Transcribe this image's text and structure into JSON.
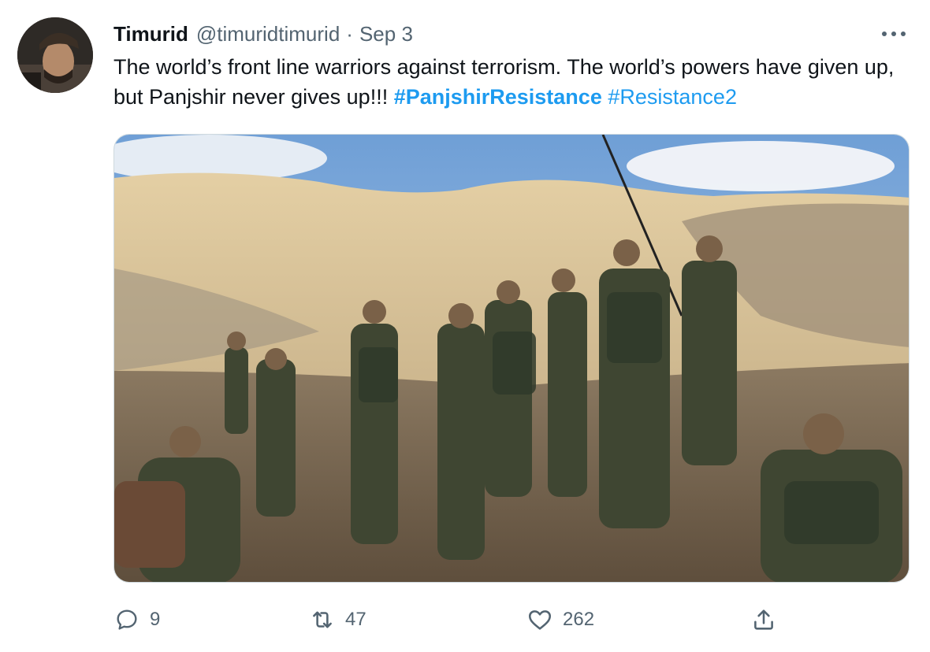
{
  "author": {
    "name": "Timurid",
    "handle": "@timuridtimurid",
    "separator": "·",
    "date": "Sep 3"
  },
  "tweet": {
    "text_part1": "The world’s front line warriors against terrorism. The world’s powers have given up, but Panjshir never gives up!!! ",
    "hashtag1": "#PanjshirResistance",
    "text_part2": " ",
    "hashtag2": "#Resistance2"
  },
  "actions": {
    "replies": "9",
    "retweets": "47",
    "likes": "262"
  },
  "icons": {
    "more": "more-dots-icon",
    "reply": "reply-icon",
    "retweet": "retweet-icon",
    "like": "heart-icon",
    "share": "share-icon"
  },
  "colors": {
    "accent": "#1d9bf0",
    "secondary_text": "#536471",
    "primary_text": "#0f1419"
  }
}
